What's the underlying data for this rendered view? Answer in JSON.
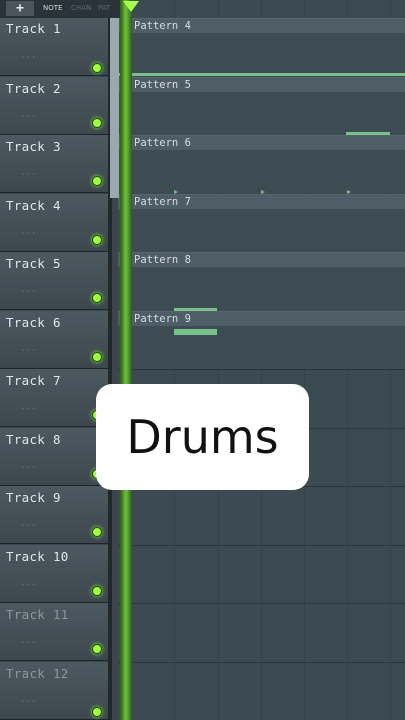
{
  "toolbar": {
    "add_label": "+",
    "tabs": [
      {
        "label": "NOTE",
        "active": true
      },
      {
        "label": "CHAN",
        "active": false
      },
      {
        "label": "PAT",
        "active": false
      }
    ]
  },
  "tracks": [
    {
      "label": "Track 1",
      "dots": "...",
      "active": true
    },
    {
      "label": "Track 2",
      "dots": "...",
      "active": true
    },
    {
      "label": "Track 3",
      "dots": "...",
      "active": true
    },
    {
      "label": "Track 4",
      "dots": "...",
      "active": true
    },
    {
      "label": "Track 5",
      "dots": "...",
      "active": true
    },
    {
      "label": "Track 6",
      "dots": "...",
      "active": true
    },
    {
      "label": "Track 7",
      "dots": "...",
      "active": true
    },
    {
      "label": "Track 8",
      "dots": "...",
      "active": true
    },
    {
      "label": "Track 9",
      "dots": "...",
      "active": true
    },
    {
      "label": "Track 10",
      "dots": "...",
      "active": true
    },
    {
      "label": "Track 11",
      "dots": "...",
      "active": false
    },
    {
      "label": "Track 12",
      "dots": "...",
      "active": false
    }
  ],
  "clips": [
    {
      "name": "Pattern 4",
      "track": 1
    },
    {
      "name": "Pattern 5",
      "track": 2
    },
    {
      "name": "Pattern 6",
      "track": 3
    },
    {
      "name": "Pattern 7",
      "track": 4
    },
    {
      "name": "Pattern 8",
      "track": 5
    },
    {
      "name": "Pattern 9",
      "track": 6
    }
  ],
  "caption": {
    "text": "Drums"
  },
  "colors": {
    "accent": "#9dff3f",
    "playhead": "#6cc536",
    "note": "#78c08a"
  }
}
